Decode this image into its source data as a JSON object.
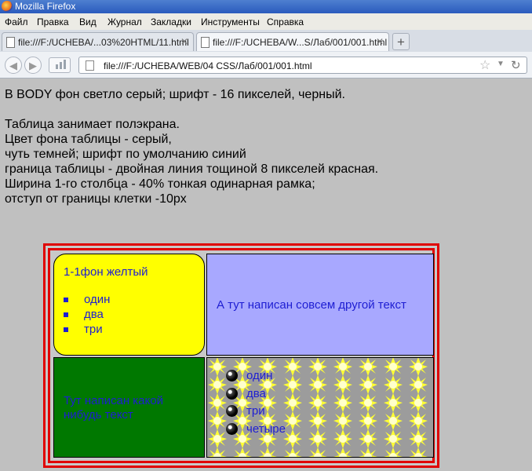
{
  "window": {
    "title": "Mozilla Firefox"
  },
  "menu": [
    "Файл",
    "Правка",
    "Вид",
    "Журнал",
    "Закладки",
    "Инструменты",
    "Справка"
  ],
  "tabs": [
    {
      "label": "file:///F:/UCHEBA/...03%20HTML/11.html",
      "active": false
    },
    {
      "label": "file:///F:/UCHEBA/W...S/Лаб/001/001.html",
      "active": true
    }
  ],
  "address": {
    "url": "file:///F:/UCHEBA/WEB/04 CSS/Лаб/001/001.html"
  },
  "page": {
    "intro": "В BODY фон светло серый; шрифт - 16 пикселей, черный.",
    "description": [
      "Таблица занимает полэкрана.",
      "Цвет фона таблицы - серый,",
      "чуть темней; шрифт по умолчанию синий",
      "граница таблицы - двойная линия тощиной 8 пикселей красная.",
      "Ширина 1-го столбца - 40% тонкая одинарная рамка;",
      "отступ от границы клетки -10px"
    ],
    "table": {
      "cell_11": {
        "heading": "1-1фон желтый",
        "items": [
          "один",
          "два",
          "три"
        ]
      },
      "cell_12": {
        "text": "А тут написан совсем другой текст"
      },
      "cell_21": {
        "text": "Тут написан какой нибудь текст"
      },
      "cell_22": {
        "items": [
          "один",
          "два",
          "три",
          "четыре"
        ]
      }
    }
  },
  "colors": {
    "body_bg": "#c0c0c0",
    "table_border": "#e00000",
    "cell_yellow": "#ffff00",
    "cell_lavender": "#a8a8ff",
    "cell_green": "#007800",
    "text_blue": "#1e1ed2"
  }
}
